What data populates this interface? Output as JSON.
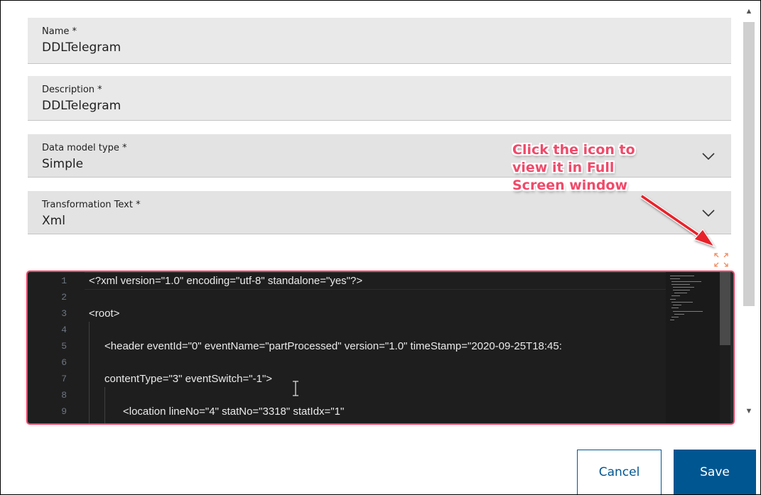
{
  "fields": {
    "name": {
      "label": "Name *",
      "value": "DDLTelegram"
    },
    "description": {
      "label": "Description *",
      "value": "DDLTelegram"
    },
    "data_model_type": {
      "label": "Data model type *",
      "value": "Simple"
    },
    "transformation_text": {
      "label": "Transformation Text *",
      "value": "Xml"
    }
  },
  "annotation": {
    "lines": [
      "Click the icon to",
      "view it in Full",
      "Screen window"
    ],
    "color": "#f04a6a"
  },
  "editor": {
    "border_color": "#e8476b",
    "lines": [
      {
        "num": "1",
        "code": "<?xml version=\"1.0\" encoding=\"utf-8\" standalone=\"yes\"?>"
      },
      {
        "num": "2",
        "code": ""
      },
      {
        "num": "3",
        "code": "<root>"
      },
      {
        "num": "4",
        "code": ""
      },
      {
        "num": "5",
        "code": "<header eventId=\"0\" eventName=\"partProcessed\" version=\"1.0\" timeStamp=\"2020-09-25T18:45:"
      },
      {
        "num": "6",
        "code": ""
      },
      {
        "num": "7",
        "code": "contentType=\"3\" eventSwitch=\"-1\">"
      },
      {
        "num": "8",
        "code": ""
      },
      {
        "num": "9",
        "code": "<location lineNo=\"4\" statNo=\"3318\" statIdx=\"1\""
      }
    ]
  },
  "icons": {
    "fullscreen": "expand-fullscreen-icon",
    "chevron": "chevron-down-icon",
    "scroll_up": "▲",
    "scroll_down": "▼"
  },
  "buttons": {
    "cancel": "Cancel",
    "save": "Save"
  },
  "colors": {
    "primary": "#005691",
    "field_bg": "#e9e9e9",
    "editor_bg": "#1e1e1e",
    "accent_icon": "#f08a5d"
  }
}
